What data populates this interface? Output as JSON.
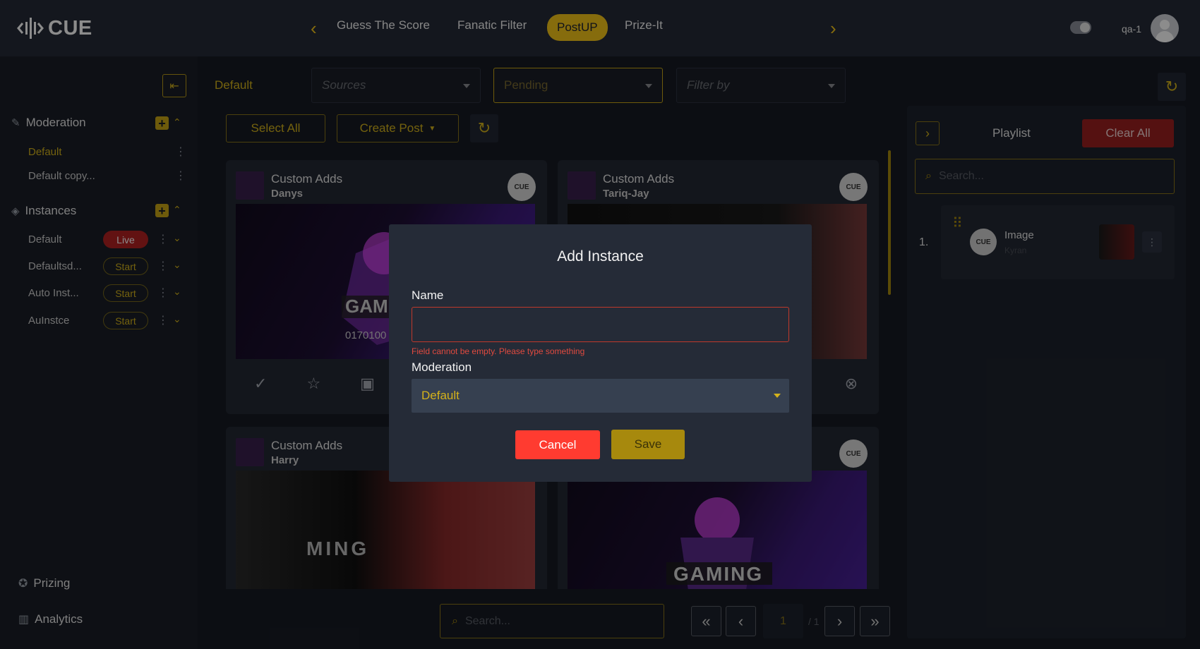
{
  "app": {
    "logo_text": "CUE"
  },
  "nav": {
    "tabs": [
      {
        "label": "Guess The Score"
      },
      {
        "label": "Fanatic Filter"
      },
      {
        "label": "PostUP"
      },
      {
        "label": "Prize-It"
      }
    ],
    "user_name": "qa-1"
  },
  "sidebar": {
    "moderation": {
      "title": "Moderation",
      "items": [
        {
          "label": "Default"
        },
        {
          "label": "Default copy..."
        }
      ]
    },
    "instances": {
      "title": "Instances",
      "items": [
        {
          "label": "Default",
          "status": "Live"
        },
        {
          "label": "Defaultsd...",
          "status": "Start"
        },
        {
          "label": "Auto Inst...",
          "status": "Start"
        },
        {
          "label": "AuInstce",
          "status": "Start"
        }
      ]
    },
    "footer": [
      {
        "label": "Prizing"
      },
      {
        "label": "Analytics"
      }
    ]
  },
  "filters": {
    "moderation_label": "Default",
    "sources_placeholder": "Sources",
    "status_value": "Pending",
    "filter_placeholder": "Filter by",
    "select_all": "Select All",
    "create_post": "Create Post"
  },
  "posts": [
    {
      "title": "Custom Adds",
      "author": "Danys",
      "caption": "0170100"
    },
    {
      "title": "Custom Adds",
      "author": "Tariq-Jay"
    },
    {
      "title": "Custom Adds",
      "author": "Harry"
    },
    {
      "title": "",
      "author": ""
    }
  ],
  "playlist": {
    "title": "Playlist",
    "clear_all": "Clear All",
    "search_placeholder": "Search...",
    "items": [
      {
        "index": "1.",
        "type": "Image",
        "author": "Kyran"
      }
    ]
  },
  "pager": {
    "search_placeholder": "Search...",
    "page": "1",
    "total": "/ 1"
  },
  "modal": {
    "title": "Add Instance",
    "name_label": "Name",
    "name_value": "",
    "name_error": "Field cannot be empty. Please type something",
    "moderation_label": "Moderation",
    "moderation_value": "Default",
    "cancel": "Cancel",
    "save": "Save"
  },
  "colors": {
    "accent": "#f5c518",
    "danger": "#ff3b30",
    "live": "#b22222",
    "background": "#171b24"
  }
}
